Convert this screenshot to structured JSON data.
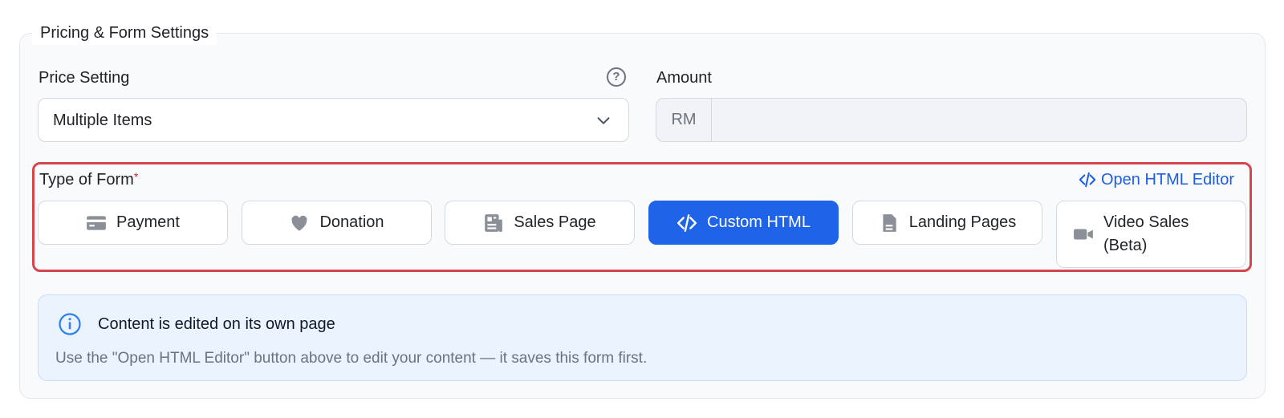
{
  "section": {
    "legend": "Pricing & Form Settings"
  },
  "price_setting": {
    "label": "Price Setting",
    "help_icon": "question-circle-icon",
    "selected": "Multiple Items"
  },
  "amount": {
    "label": "Amount",
    "currency_prefix": "RM",
    "value": ""
  },
  "form_type": {
    "label": "Type of Form",
    "required_mark": "*",
    "editor_link": "Open HTML Editor",
    "highlight_color": "#d6454b",
    "options": [
      {
        "label": "Payment",
        "icon": "credit-card-icon"
      },
      {
        "label": "Donation",
        "icon": "heart-icon"
      },
      {
        "label": "Sales Page",
        "icon": "newspaper-icon"
      },
      {
        "label": "Custom HTML",
        "icon": "code-icon",
        "selected": true
      },
      {
        "label": "Landing Pages",
        "icon": "document-icon"
      },
      {
        "label": "Video Sales (Beta)",
        "icon": "video-camera-icon"
      }
    ]
  },
  "notice": {
    "icon": "info-icon",
    "title": "Content is edited on its own page",
    "text": "Use the \"Open HTML Editor\" button above to edit your content — it saves this form first."
  },
  "colors": {
    "accent": "#1f63e8",
    "link": "#1d5fe0",
    "info_bg": "#eaf3fe"
  }
}
